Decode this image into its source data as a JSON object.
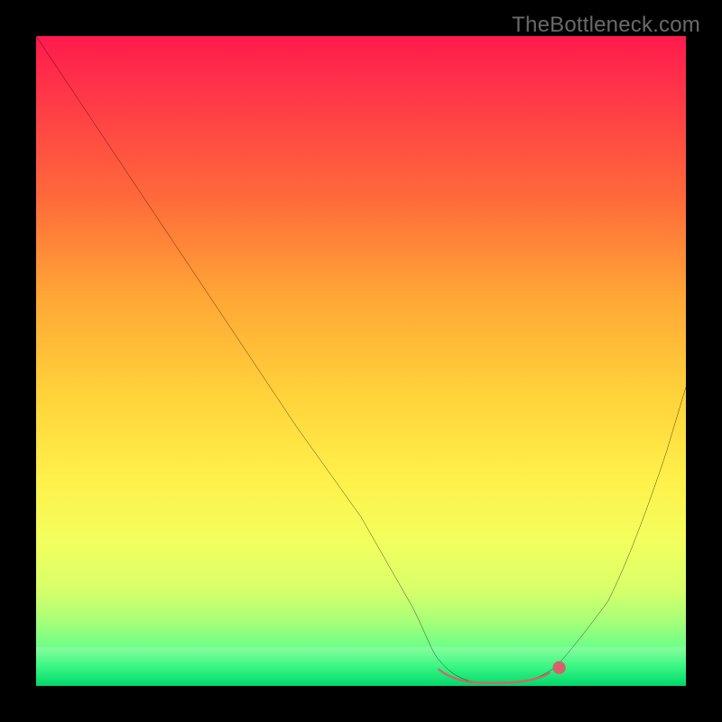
{
  "watermark": "TheBottleneck.com",
  "chart_data": {
    "type": "line",
    "title": "",
    "xlabel": "",
    "ylabel": "",
    "xlim": [
      0,
      100
    ],
    "ylim": [
      0,
      100
    ],
    "grid": false,
    "legend": false,
    "series": [
      {
        "name": "curve",
        "color": "#000000",
        "x": [
          0,
          10,
          20,
          30,
          40,
          50,
          58,
          62,
          66,
          70,
          74,
          78,
          82,
          88,
          94,
          100
        ],
        "values": [
          100,
          85,
          70,
          55,
          40,
          26,
          12,
          4,
          1,
          0,
          0,
          1,
          3,
          12,
          26,
          46
        ]
      },
      {
        "name": "highlight-band",
        "color": "#d6636b",
        "x": [
          62,
          66,
          70,
          74,
          78
        ],
        "values": [
          2.5,
          0.8,
          0.5,
          0.8,
          2.2
        ]
      },
      {
        "name": "highlight-dot",
        "color": "#d6636b",
        "x": [
          80
        ],
        "values": [
          3
        ]
      }
    ],
    "background_gradient": {
      "top": "#ff1a4d",
      "mid": "#fff04a",
      "bottom": "#00d86b"
    }
  }
}
